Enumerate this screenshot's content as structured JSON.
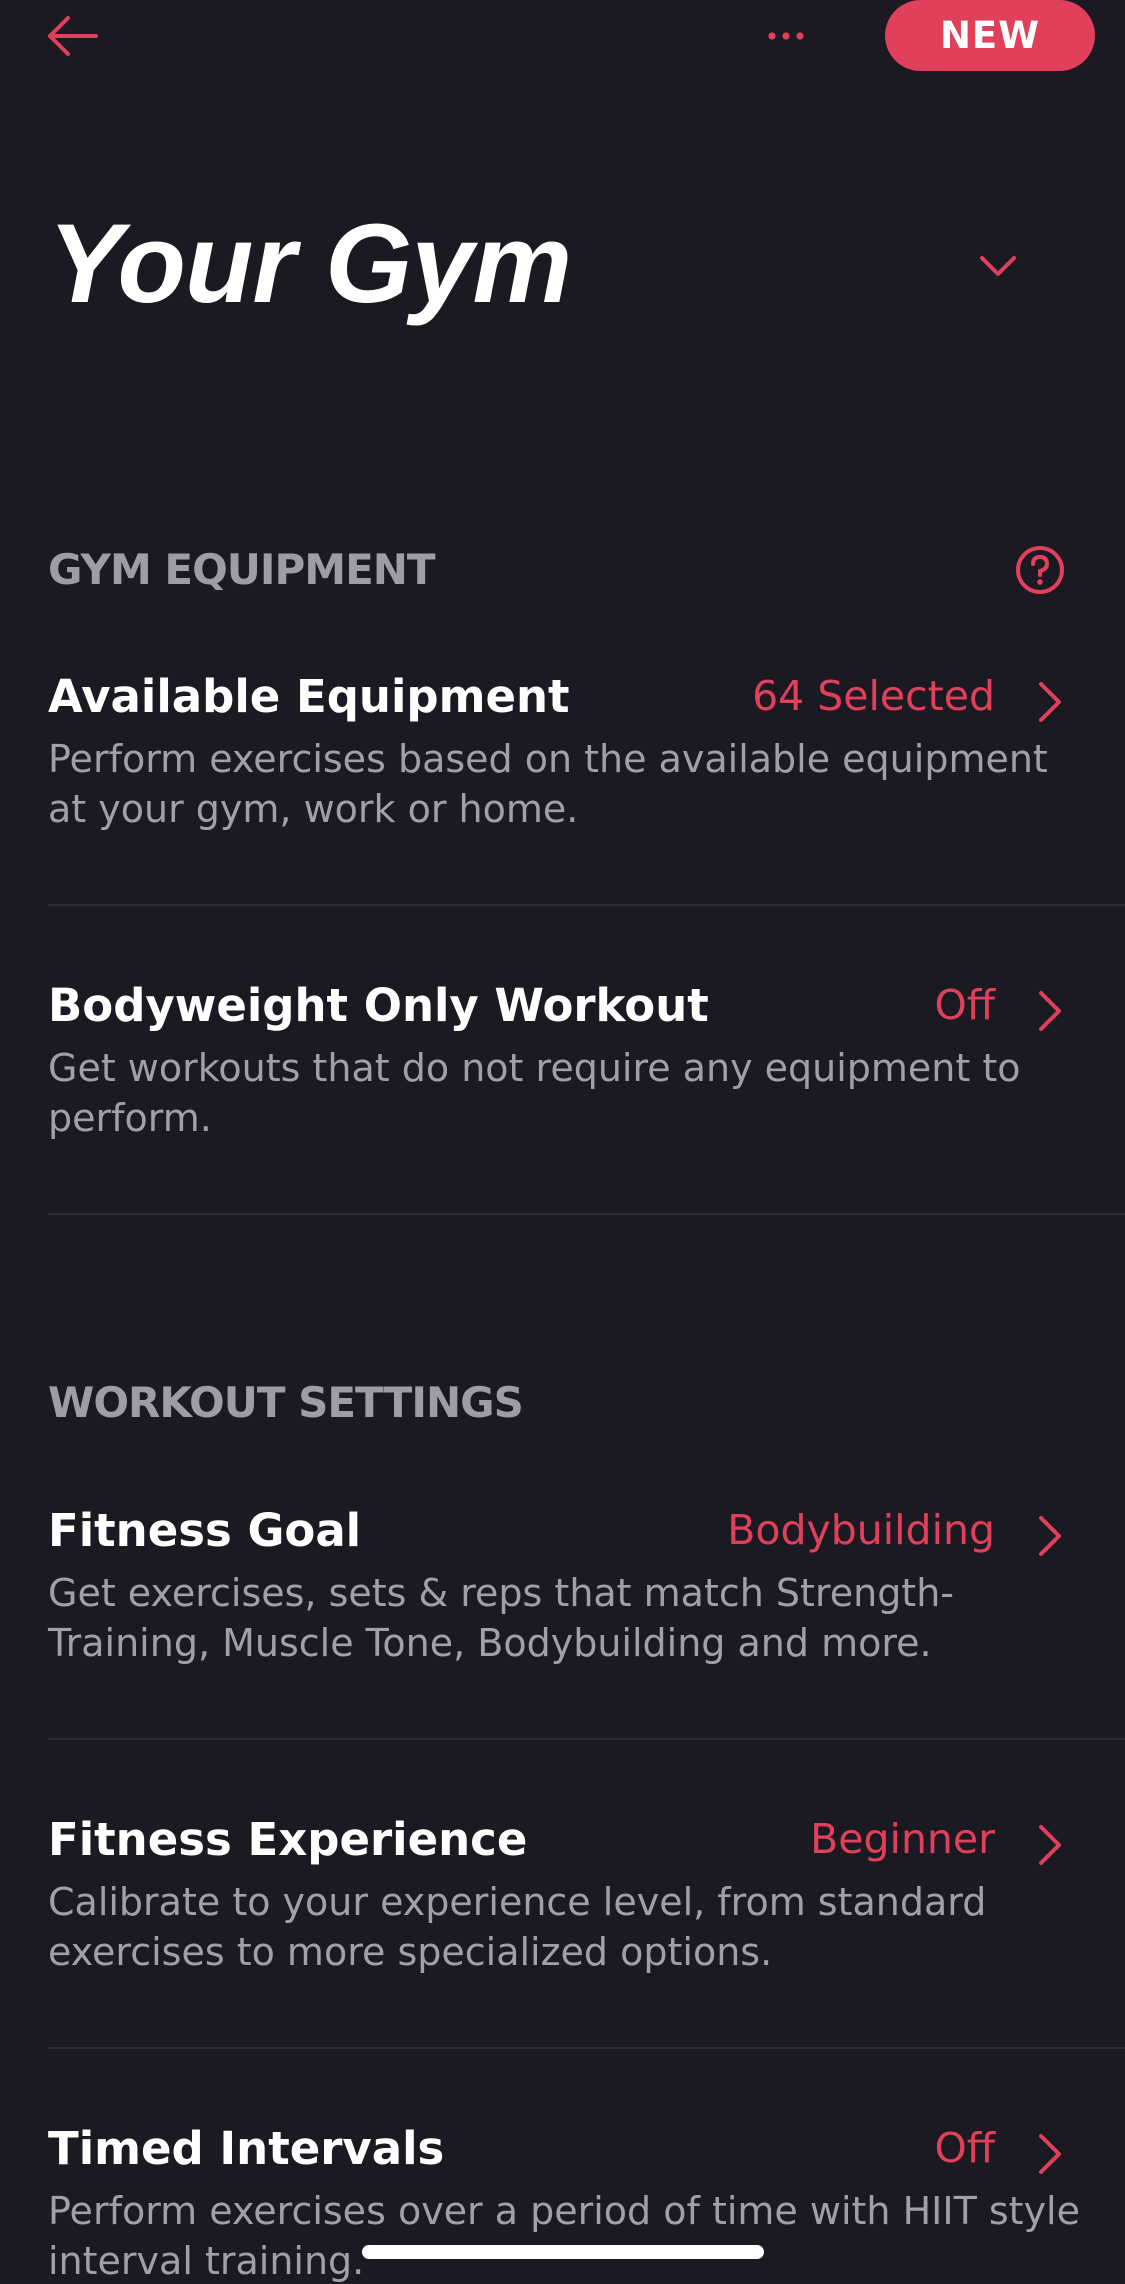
{
  "header": {
    "back_icon": "arrow-left-icon",
    "more_icon": "more-horizontal-icon",
    "new_label": "NEW"
  },
  "title": {
    "text": "Your Gym",
    "dropdown_icon": "chevron-down-icon"
  },
  "sections": {
    "equipment": {
      "header": "GYM EQUIPMENT",
      "help_icon": "help-circle-icon",
      "rows": [
        {
          "title": "Available Equipment",
          "value": "64 Selected",
          "description": "Perform exercises based on the available equipment at your gym, work or home."
        },
        {
          "title": "Bodyweight Only Workout",
          "value": "Off",
          "description": "Get workouts that do not require any equipment to perform."
        }
      ]
    },
    "workout": {
      "header": "WORKOUT SETTINGS",
      "rows": [
        {
          "title": "Fitness Goal",
          "value": "Bodybuilding",
          "description": "Get exercises, sets & reps that match Strength-Training, Muscle Tone, Bodybuilding and more."
        },
        {
          "title": "Fitness Experience",
          "value": "Beginner",
          "description": "Calibrate to your experience level, from standard exercises to more specialized options."
        },
        {
          "title": "Timed Intervals",
          "value": "Off",
          "description": "Perform exercises over a period of time with HIIT style interval training."
        }
      ]
    }
  },
  "colors": {
    "background": "#1b1a22",
    "accent": "#e0405a",
    "primary_text": "#ffffff",
    "secondary_text": "#a19fa8",
    "section_header": "#9e9ca6",
    "divider": "#2c2b33"
  }
}
